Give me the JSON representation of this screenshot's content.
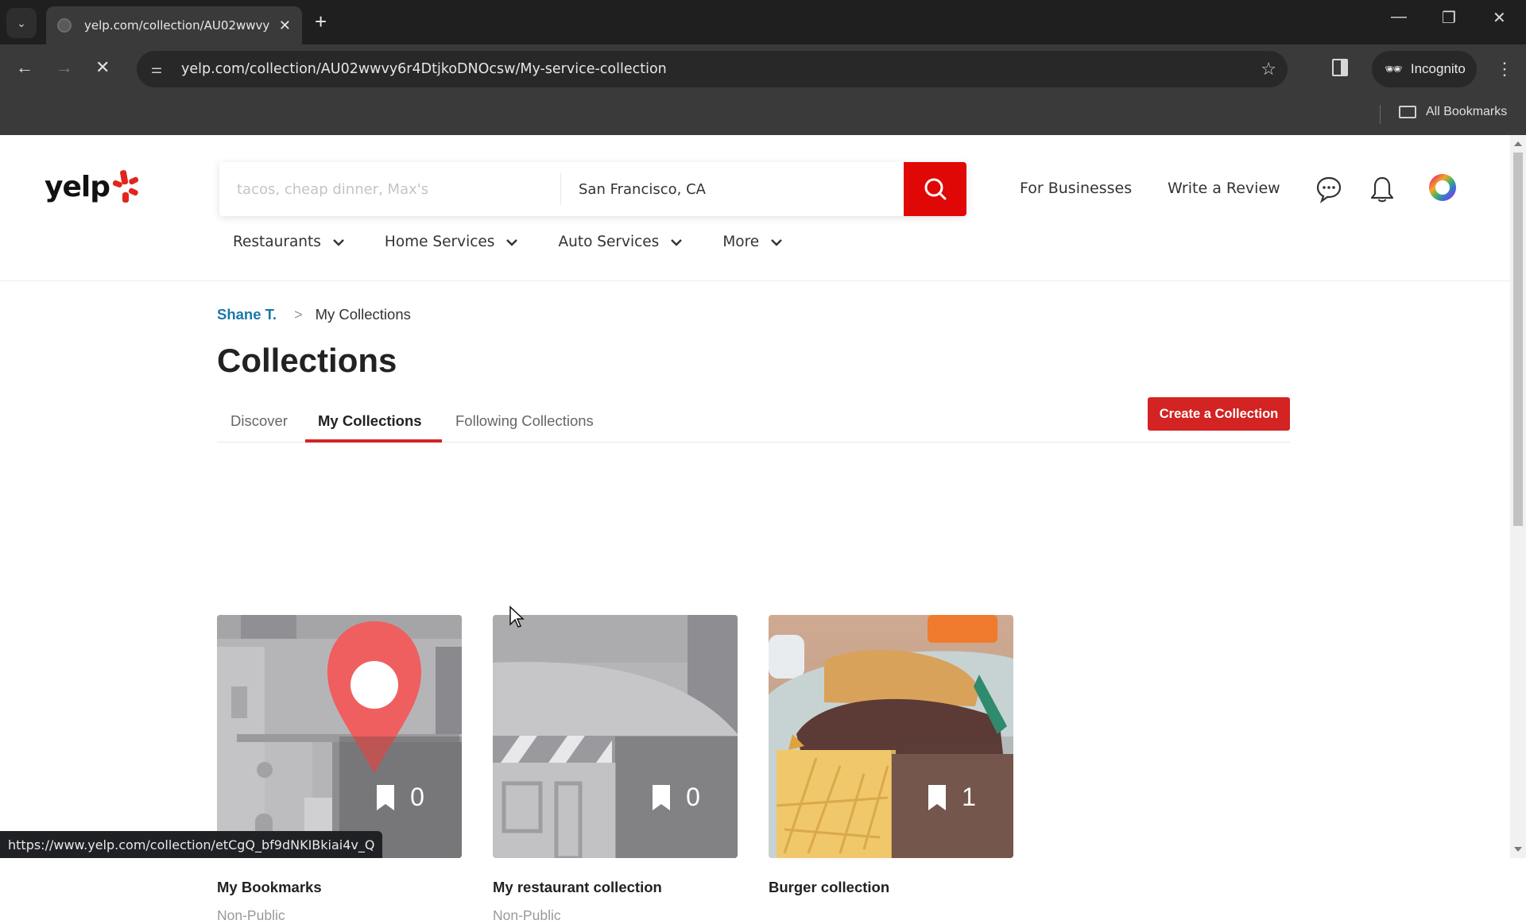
{
  "browser": {
    "tab_title": "yelp.com/collection/AU02wwvy",
    "url": "yelp.com/collection/AU02wwvy6r4DtjkoDNOcsw/My-service-collection",
    "incognito_label": "Incognito",
    "all_bookmarks_label": "All Bookmarks",
    "status_url": "https://www.yelp.com/collection/etCgQ_bf9dNKIBkiai4v_Q"
  },
  "header": {
    "logo_text": "yelp",
    "search_placeholder": "tacos, cheap dinner, Max's",
    "location_value": "San Francisco, CA",
    "for_businesses": "For Businesses",
    "write_review": "Write a Review",
    "categories": [
      {
        "label": "Restaurants"
      },
      {
        "label": "Home Services"
      },
      {
        "label": "Auto Services"
      },
      {
        "label": "More"
      }
    ]
  },
  "breadcrumb": {
    "user": "Shane T.",
    "current": "My Collections"
  },
  "page_title": "Collections",
  "tabs": [
    {
      "label": "Discover",
      "active": false
    },
    {
      "label": "My Collections",
      "active": true
    },
    {
      "label": "Following Collections",
      "active": false
    }
  ],
  "create_button": "Create a Collection",
  "collections": [
    {
      "name": "My Bookmarks",
      "visibility": "Non-Public",
      "count": "0",
      "image": "map-pin-illustration"
    },
    {
      "name": "My restaurant collection",
      "visibility": "Non-Public",
      "count": "0",
      "image": "storefront-illustration"
    },
    {
      "name": "Burger collection",
      "visibility": "",
      "count": "1",
      "image": "burger-fries-photo"
    }
  ],
  "colors": {
    "brand_red": "#d32323",
    "search_red": "#e00707",
    "link_blue": "#1b78a8"
  }
}
